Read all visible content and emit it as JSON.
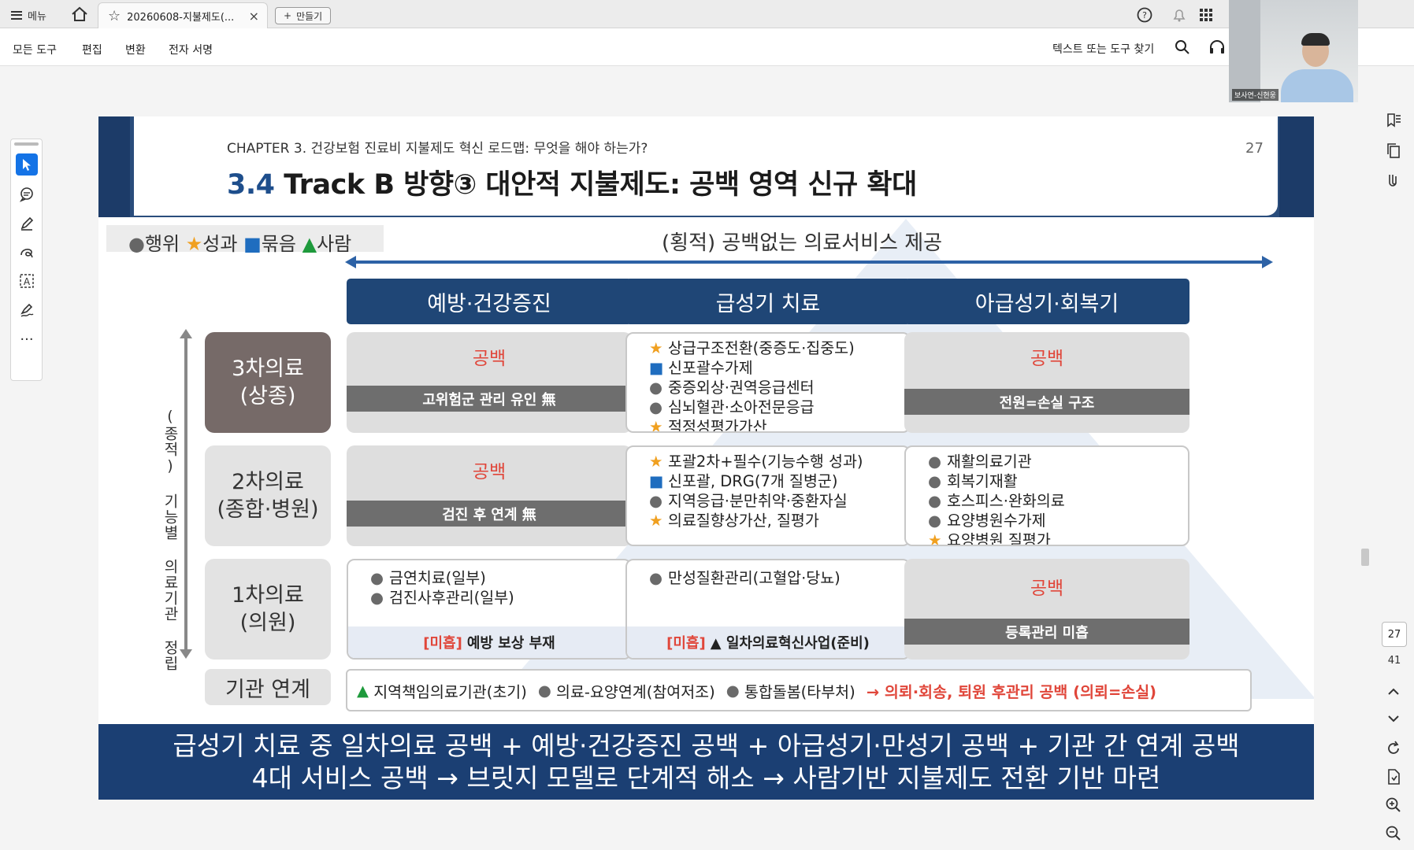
{
  "app": {
    "menu_label": "메뉴",
    "tab_title": "20260608-지불제도(...",
    "create_label": "만들기",
    "tools": [
      "모든 도구",
      "편집",
      "변환",
      "전자 서명"
    ],
    "find_tools": "텍스트 또는 도구 찾기",
    "webcam_label": "보사연-신현웅",
    "page_current": "27",
    "page_total": "41"
  },
  "slide": {
    "chapter": "CHAPTER 3. 건강보험 진료비 지불제도 혁신 로드맵: 무엇을 해야 하는가?",
    "title_num": "3.4",
    "title_text": "Track B 방향③ 대안적 지불제도: 공백 영역 신규 확대",
    "page_num": "27",
    "legend": {
      "dot": "●",
      "dot_label": "행위",
      "star": "★",
      "star_label": "성과",
      "sq": "■",
      "sq_label": "묶음",
      "tri": "▲",
      "tri_label": "사람"
    },
    "horizontal_label": "(횡적) 공백없는 의료서비스 제공",
    "vertical_label": "(종적) 기능별 의료기관 정립",
    "columns": [
      "예방·건강증진",
      "급성기 치료",
      "아급성기·회복기"
    ],
    "rows": [
      {
        "line1": "3차의료",
        "line2": "(상종)"
      },
      {
        "line1": "2차의료",
        "line2": "(종합·병원)"
      },
      {
        "line1": "1차의료",
        "line2": "(의원)"
      }
    ],
    "cells": {
      "r1c1": {
        "gap": "공백",
        "bar": "고위험군 관리 유인 無"
      },
      "r1c2": [
        {
          "m": "★",
          "t": "상급구조전환(중증도·집중도)"
        },
        {
          "m": "■",
          "t": "신포괄수가제"
        },
        {
          "m": "●",
          "t": "중증외상·권역응급센터"
        },
        {
          "m": "●",
          "t": "심뇌혈관·소아전문응급"
        },
        {
          "m": "★",
          "t": "적정성평가가산"
        }
      ],
      "r1c3": {
        "gap": "공백",
        "bar": "전원=손실 구조"
      },
      "r2c1": {
        "gap": "공백",
        "bar": "검진 후 연계 無"
      },
      "r2c2": [
        {
          "m": "★",
          "t": "포괄2차+필수(기능수행 성과)"
        },
        {
          "m": "■",
          "t": "신포괄, DRG(7개 질병군)"
        },
        {
          "m": "●",
          "t": "지역응급·분만취약·중환자실"
        },
        {
          "m": "★",
          "t": "의료질향상가산, 질평가"
        }
      ],
      "r2c3": [
        {
          "m": "●",
          "t": "재활의료기관"
        },
        {
          "m": "●",
          "t": "회복기재활"
        },
        {
          "m": "●",
          "t": "호스피스·완화의료"
        },
        {
          "m": "●",
          "t": "요양병원수가제"
        },
        {
          "m": "★",
          "t": "요양병원 질평가"
        }
      ],
      "r3c1": {
        "items": [
          {
            "m": "●",
            "t": "금연치료(일부)"
          },
          {
            "m": "●",
            "t": "검진사후관리(일부)"
          }
        ],
        "note_red": "[미흡]",
        "note": "예방 보상 부재"
      },
      "r3c2": {
        "items": [
          {
            "m": "●",
            "t": "만성질환관리(고혈압·당뇨)"
          }
        ],
        "note_red": "[미흡]",
        "note": "▲ 일차의료혁신사업(준비)"
      },
      "r3c3": {
        "gap": "공백",
        "bar": "등록관리 미흡"
      }
    },
    "link": {
      "head": "기관 연계",
      "a_mark": "▲",
      "a": "지역책임의료기관(초기)",
      "b_mark": "●",
      "b": "의료-요양연계(참여저조)",
      "c_mark": "●",
      "c": "통합돌봄(타부처)",
      "red": "→ 의뢰·회송, 퇴원 후관리 공백 (의뢰=손실)"
    },
    "footer_line1": "급성기 치료 중 일차의료 공백 + 예방·건강증진 공백 + 아급성기·만성기 공백 + 기관 간 연계 공백",
    "footer_line2": "4대 서비스 공백 → 브릿지 모델로 단계적 해소 → 사람기반 지불제도 전환 기반 마련"
  },
  "colors": {
    "navy": "#1f4676",
    "accent_red": "#e0463a",
    "star": "#f0a020",
    "square": "#1f6dbf",
    "triangle": "#1e9a3c"
  }
}
